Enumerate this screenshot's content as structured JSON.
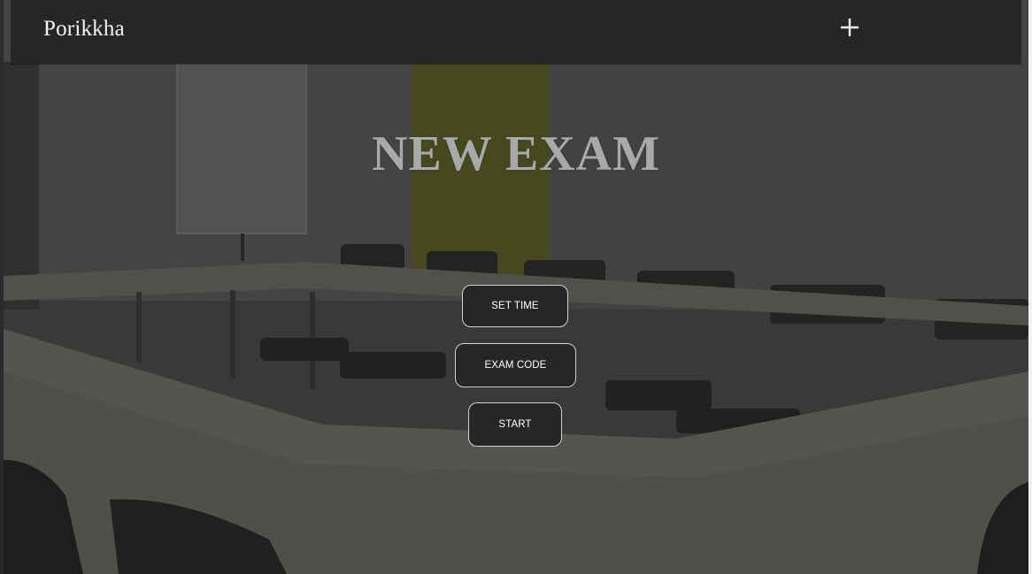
{
  "navbar": {
    "brand": "Porikkha",
    "add_icon": "plus-icon"
  },
  "hero": {
    "title": "NEW EXAM"
  },
  "actions": {
    "set_time_label": "SET TIME",
    "exam_code_label": "EXAM CODE",
    "start_label": "START"
  },
  "colors": {
    "navbar_bg": "#262626",
    "button_bg": "#262626",
    "button_border": "#d2d2d2",
    "title_color": "#a9a9a9",
    "accent_wall": "#8a8f2a"
  }
}
